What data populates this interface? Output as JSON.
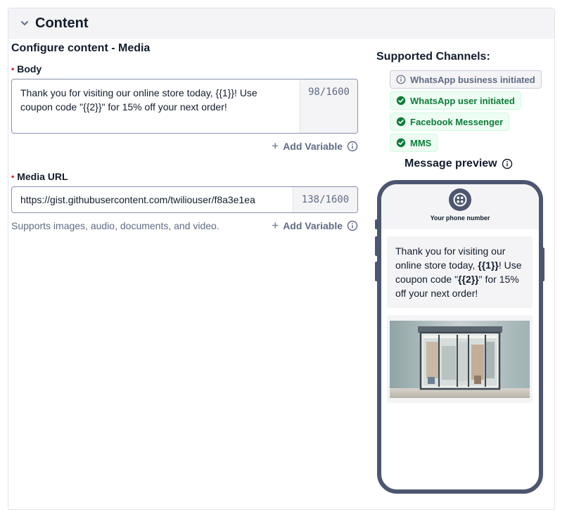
{
  "header": {
    "title": "Content"
  },
  "form": {
    "section_title": "Configure content - Media",
    "body": {
      "label": "Body",
      "text": "Thank you for visiting our online store today, {{1}}! Use coupon code \"{{2}}\" for 15% off your next order!",
      "counter": "98/1600",
      "add_variable": "Add Variable"
    },
    "media_url": {
      "label": "Media URL",
      "value": "https://gist.githubusercontent.com/twiliouser/f8a3e1ea",
      "counter": "138/1600",
      "help": "Supports images, audio, documents, and video.",
      "add_variable": "Add Variable"
    }
  },
  "channels": {
    "title": "Supported Channels:",
    "items": [
      {
        "label": "WhatsApp business initiated",
        "status": "info"
      },
      {
        "label": "WhatsApp user initiated",
        "status": "success"
      },
      {
        "label": "Facebook Messenger",
        "status": "success"
      },
      {
        "label": "MMS",
        "status": "success"
      }
    ]
  },
  "preview": {
    "title": "Message preview",
    "phone_number": "Your phone number",
    "message_before_1": "Thank you for visiting our online store today, ",
    "var_1": "{{1}}",
    "message_between": "! Use coupon code \"",
    "var_2": "{{2}}",
    "message_after": "\" for 15% off your next order!"
  },
  "colors": {
    "accent_success": "#0e7c3a",
    "phone_frame": "#4d5670",
    "required": "#d61f1f"
  }
}
